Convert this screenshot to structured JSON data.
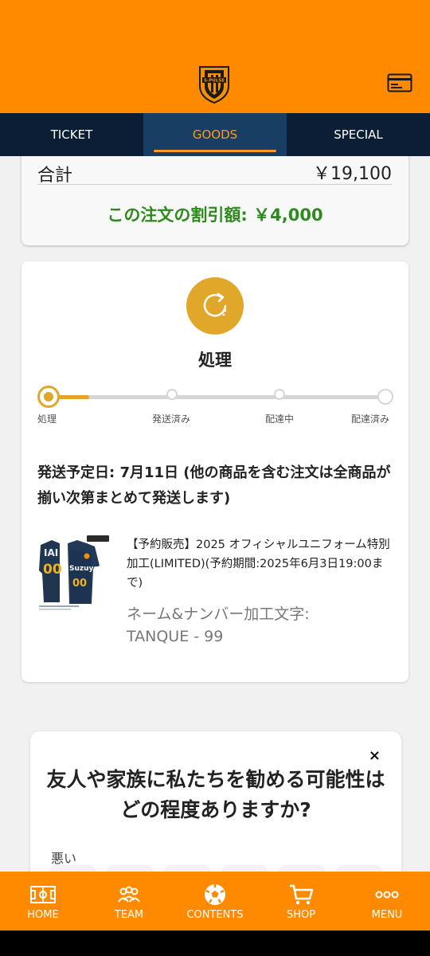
{
  "header": {
    "logo_alt": "S-PULSE crest",
    "crest_text": "S-PULSE"
  },
  "tabs": [
    {
      "label": "TICKET",
      "active": false
    },
    {
      "label": "GOODS",
      "active": true
    },
    {
      "label": "SPECIAL",
      "active": false
    }
  ],
  "summary": {
    "total_label": "合計",
    "total_value": "￥19,100",
    "discount_text": "この注文の割引額: ￥4,000"
  },
  "status": {
    "title": "処理",
    "progress_percent": 12,
    "steps": [
      {
        "label": "処理"
      },
      {
        "label": "発送済み"
      },
      {
        "label": "配達中"
      },
      {
        "label": "配達済み"
      }
    ],
    "shipping_note": "発送予定日: 7月11日 (他の商品を含む注文は全商品が揃い次第まとめて発送します)"
  },
  "product": {
    "name": "【予約販売】2025 オフィシャルユニフォーム特別加工(LIMITED)(予約期間:2025年6月3日19:00まで)",
    "customization_label": "ネーム&ナンバー加工文字:",
    "customization_value": "TANQUE - 99",
    "jersey_name": "IAI",
    "jersey_number": "00",
    "jersey_sponsor": "Suzuyo"
  },
  "survey": {
    "question": "友人や家族に私たちを勧める可能性はどの程度ありますか?",
    "low_label": "悪い",
    "close_symbol": "×"
  },
  "bottom_nav": [
    {
      "label": "HOME",
      "icon": "field-icon"
    },
    {
      "label": "TEAM",
      "icon": "team-icon"
    },
    {
      "label": "CONTENTS",
      "icon": "ball-icon"
    },
    {
      "label": "SHOP",
      "icon": "cart-icon"
    },
    {
      "label": "MENU",
      "icon": "more-icon"
    }
  ],
  "colors": {
    "brand_orange": "#ff8a00",
    "navy": "#0c1e36",
    "status_gold": "#e0a72a",
    "discount_green": "#2f8a1e"
  }
}
